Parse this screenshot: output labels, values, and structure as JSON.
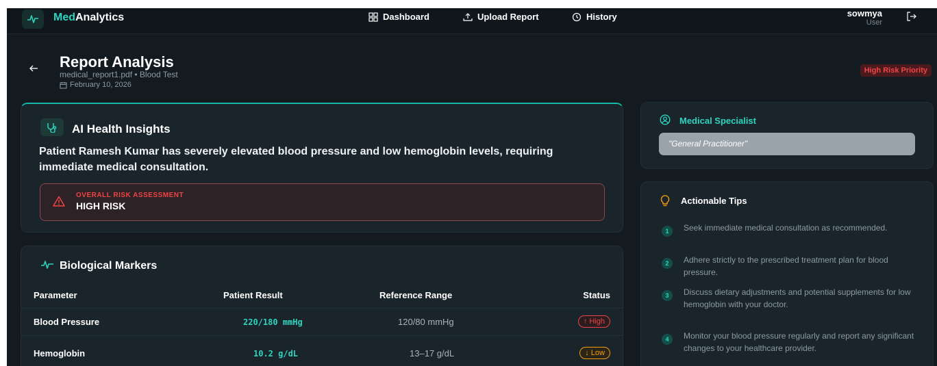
{
  "app": {
    "brand_prefix": "Med",
    "brand_suffix": "Analytics"
  },
  "nav": {
    "dashboard": "Dashboard",
    "upload": "Upload Report",
    "history": "History"
  },
  "user": {
    "name": "sowmya",
    "role": "User"
  },
  "report": {
    "title": "Report Analysis",
    "subtitle": "medical_report1.pdf • Blood Test",
    "date": "February 10, 2026",
    "priority": "High Risk Priority"
  },
  "insights": {
    "title": "AI Health Insights",
    "summary": "Patient Ramesh Kumar has severely elevated blood pressure and low hemoglobin levels, requiring immediate medical consultation.",
    "risk_label": "OVERALL RISK ASSESSMENT",
    "risk_value": "HIGH RISK"
  },
  "markers": {
    "title": "Biological Markers",
    "columns": [
      "Parameter",
      "Patient Result",
      "Reference Range",
      "Status"
    ],
    "rows": [
      {
        "parameter": "Blood Pressure",
        "result": "220/180 mmHg",
        "range": "120/80 mmHg",
        "status": "↑ High"
      },
      {
        "parameter": "Hemoglobin",
        "result": "10.2 g/dL",
        "range": "13–17 g/dL",
        "status": "↓ Low"
      }
    ]
  },
  "specialist": {
    "title": "Medical Specialist",
    "value": "\"General Practitioner\""
  },
  "tips": {
    "title": "Actionable Tips",
    "items": [
      {
        "num": "1",
        "text": "Seek immediate medical consultation as recommended."
      },
      {
        "num": "2",
        "text": "Adhere strictly to the prescribed treatment plan for blood pressure."
      },
      {
        "num": "3",
        "text": "Discuss dietary adjustments and potential supplements for low hemoglobin with your doctor."
      },
      {
        "num": "4",
        "text": "Monitor your blood pressure regularly and report any significant changes to your healthcare provider."
      }
    ]
  },
  "colors": {
    "accent": "#2dd4bf",
    "danger": "#ef4444",
    "warning": "#f59e0b",
    "background": "#131b21"
  }
}
